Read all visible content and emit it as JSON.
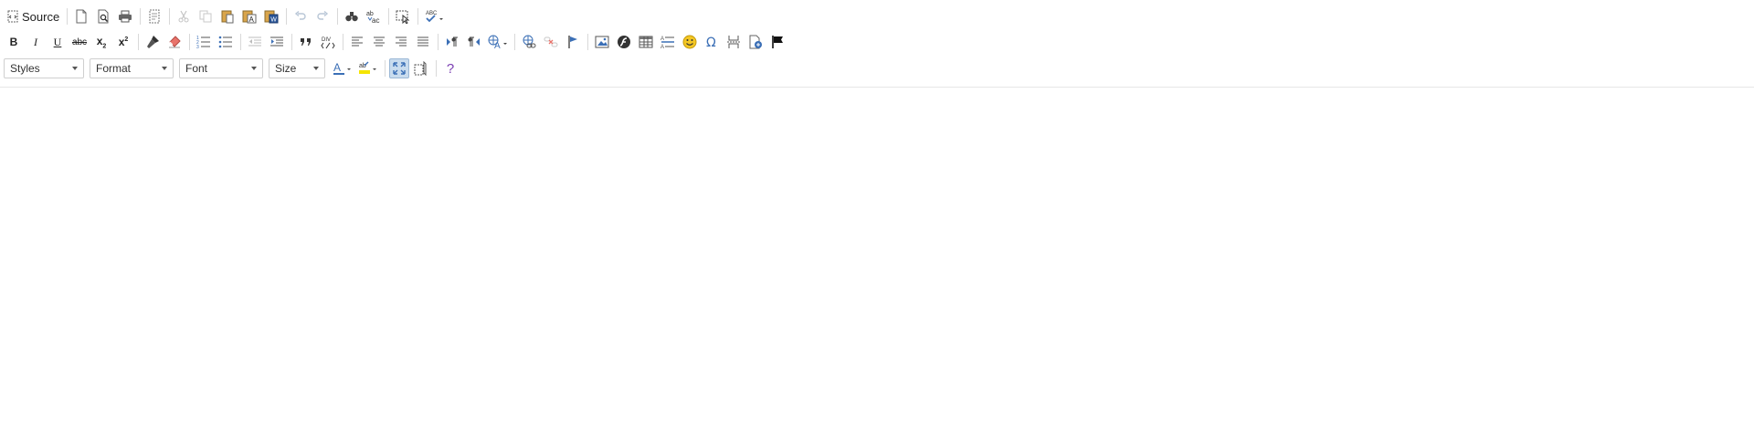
{
  "toolbar": {
    "source_label": "Source",
    "bold_label": "B",
    "italic_label": "I",
    "underline_label": "U",
    "strike_label": "abc",
    "subscript_label": "x",
    "subscript_sub": "2",
    "superscript_label": "x",
    "superscript_sup": "2",
    "spell_label": "ABC",
    "help_label": "?"
  },
  "combos": {
    "styles": "Styles",
    "format": "Format",
    "font": "Font",
    "size": "Size"
  },
  "colors": {
    "icon_gray": "#555555",
    "icon_disabled": "#bfbfbf",
    "icon_blue": "#3b6fb6",
    "icon_orange": "#d9822b",
    "highlight_yellow": "#f5e500",
    "emoji_yellow": "#f3c623",
    "help_purple": "#7b3fb3",
    "active_bg": "#c9dcee"
  },
  "icons": [
    "document-source-icon",
    "new-page-icon",
    "preview-icon",
    "print-icon",
    "templates-icon",
    "cut-icon",
    "copy-icon",
    "paste-icon",
    "paste-text-icon",
    "paste-word-icon",
    "undo-icon",
    "redo-icon",
    "find-icon",
    "replace-icon",
    "select-all-icon",
    "spellcheck-icon",
    "remove-format-icon",
    "copy-format-icon",
    "numbered-list-icon",
    "bulleted-list-icon",
    "outdent-icon",
    "indent-icon",
    "blockquote-icon",
    "div-container-icon",
    "align-left-icon",
    "align-center-icon",
    "align-right-icon",
    "justify-icon",
    "ltr-icon",
    "rtl-icon",
    "language-icon",
    "link-icon",
    "unlink-icon",
    "anchor-icon",
    "image-icon",
    "flash-icon",
    "table-icon",
    "horizontal-line-icon",
    "smiley-icon",
    "omega-icon",
    "page-break-icon",
    "iframe-icon",
    "flag-icon",
    "text-color-icon",
    "bg-color-icon",
    "maximize-icon",
    "show-blocks-icon",
    "help-icon"
  ]
}
